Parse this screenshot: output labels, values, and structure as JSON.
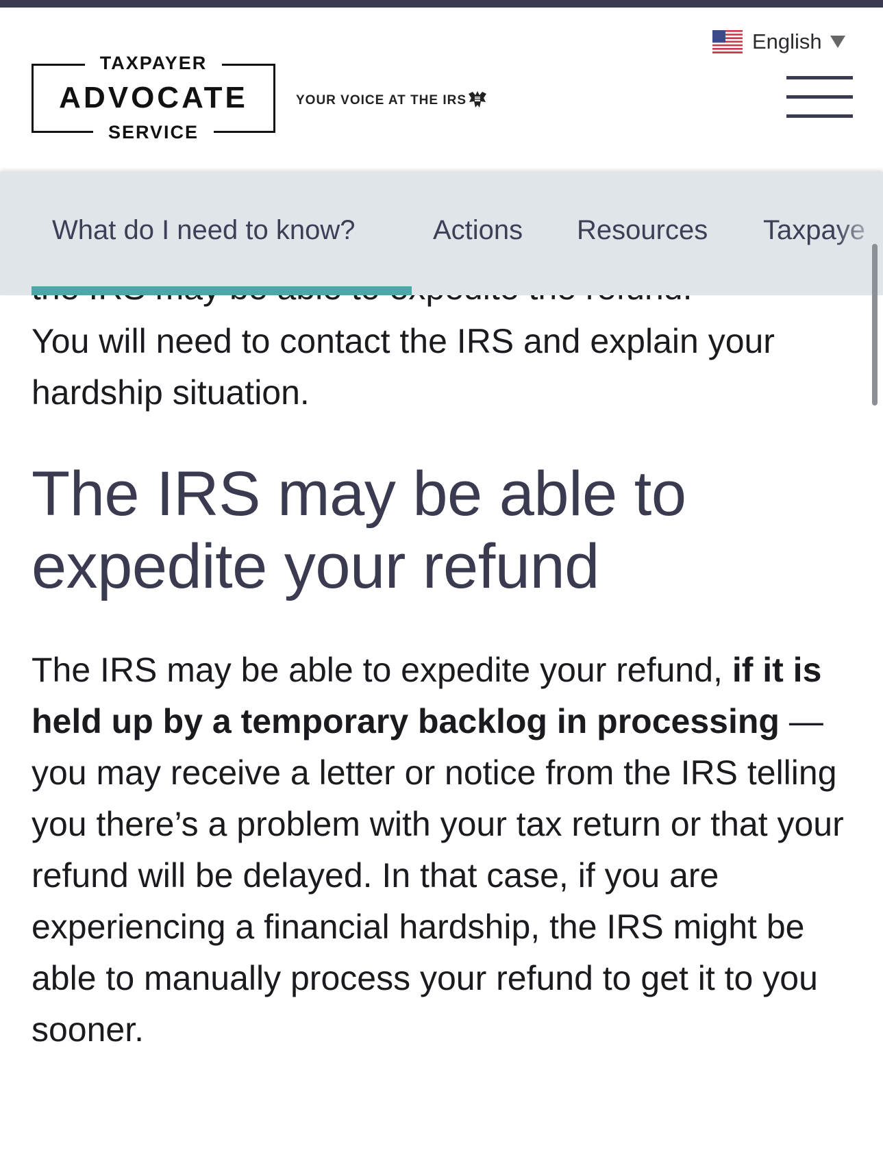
{
  "header": {
    "logo": {
      "line1": "TAXPAYER",
      "line2": "ADVOCATE",
      "line3": "SERVICE"
    },
    "tagline": "YOUR VOICE AT THE IRS",
    "language": {
      "label": "English",
      "flag_icon": "us-flag-icon"
    },
    "menu_icon": "hamburger-menu-icon"
  },
  "tabs": [
    {
      "label": "What do I need to know?",
      "active": true
    },
    {
      "label": "Actions"
    },
    {
      "label": "Resources"
    },
    {
      "label": "Taxpaye"
    }
  ],
  "colors": {
    "accent": "#4ba8a8",
    "heading": "#3a3b50",
    "tabbar": "#e0e5e9",
    "topbar": "#3a3b50"
  },
  "content": {
    "partial_line": "the IRS may be able to expedite the refund.",
    "para1": "You will need to contact the IRS and explain your hardship situation.",
    "heading": "The IRS may be able to expedite your refund",
    "para2": {
      "before": "The IRS may be able to expedite your refund, ",
      "bold": "if it is held up by a temporary backlog in processing",
      "after": " — you may receive a letter or notice from the IRS telling you there’s a problem with your tax return or that your refund will be delayed. In that case, if you are experiencing a financial hardship, the IRS might be able to manually process your refund to get it to you sooner."
    }
  }
}
